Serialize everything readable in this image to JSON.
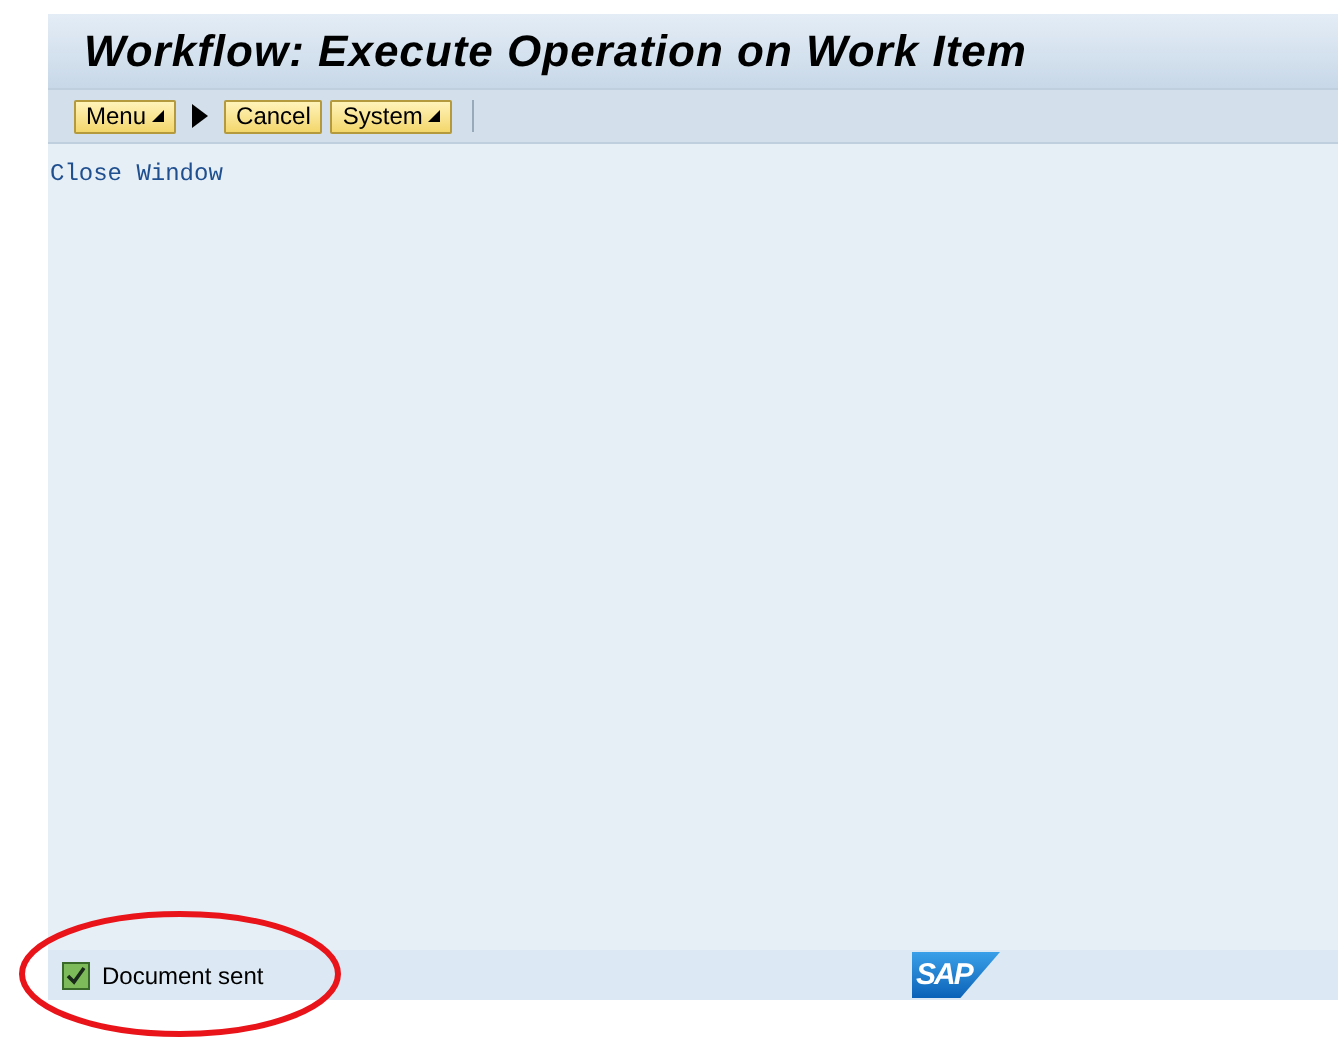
{
  "window": {
    "title": "Workflow: Execute Operation on Work Item"
  },
  "toolbar": {
    "buttons": [
      {
        "label": "Menu",
        "kind": "dropdown"
      },
      {
        "kind": "arrow"
      },
      {
        "label": "Cancel",
        "kind": "plain"
      },
      {
        "label": "System",
        "kind": "dropdown"
      }
    ]
  },
  "content": {
    "link": "Close Window"
  },
  "status_bar": {
    "message": "Document sent",
    "kind": "success",
    "logo": "SAP"
  }
}
